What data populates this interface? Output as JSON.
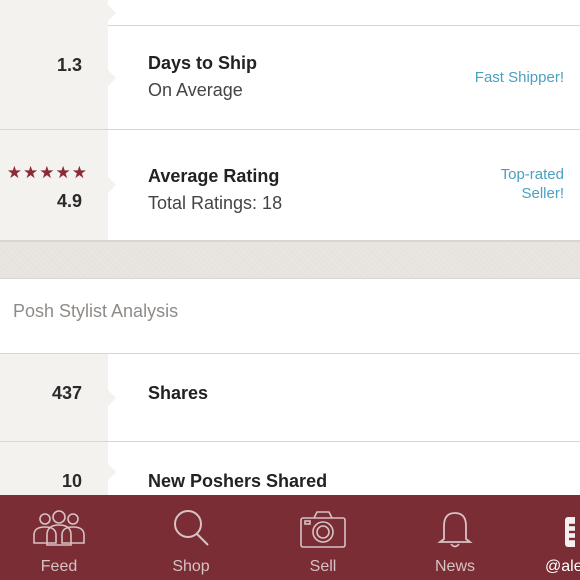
{
  "stats": [
    {
      "value": "1.3",
      "title": "Days to Ship",
      "subtitle": "On Average",
      "badge_line1": "Fast Shipper!",
      "badge_line2": ""
    },
    {
      "value": "4.9",
      "title": "Average Rating",
      "subtitle": "Total Ratings: 18",
      "badge_line1": "Top-rated",
      "badge_line2": "Seller!",
      "stars": "★★★★★",
      "star_color": "#8b2b3a"
    }
  ],
  "analysis": {
    "heading": "Posh Stylist Analysis",
    "rows": [
      {
        "value": "437",
        "label": "Shares"
      },
      {
        "value": "10",
        "label": "New Poshers Shared"
      }
    ]
  },
  "tabbar": {
    "background": "#7a2d35",
    "tabs": [
      {
        "label": "Feed",
        "icon": "people-icon"
      },
      {
        "label": "Shop",
        "icon": "search-icon"
      },
      {
        "label": "Sell",
        "icon": "camera-icon"
      },
      {
        "label": "News",
        "icon": "bell-icon"
      },
      {
        "label": "@ale",
        "icon": "menu-icon"
      }
    ]
  },
  "colors": {
    "accent_link": "#4aa0c2",
    "muted_panel": "#f4f2ef"
  }
}
